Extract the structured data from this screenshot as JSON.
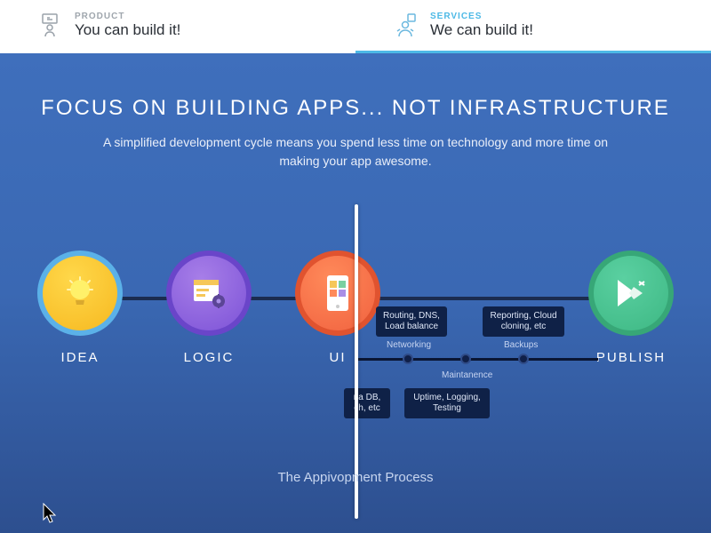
{
  "tabs": {
    "product": {
      "eyebrow": "PRODUCT",
      "title": "You can build it!"
    },
    "services": {
      "eyebrow": "SERVICES",
      "title": "We can build it!"
    }
  },
  "hero": {
    "heading": "FOCUS ON BUILDING APPS... NOT INFRASTRUCTURE",
    "subtext": "A simplified development cycle means you spend less time on technology and more time on making your app awesome."
  },
  "nodes": {
    "idea": "IDEA",
    "logic": "LOGIC",
    "ui": "UI",
    "publish": "PUBLISH"
  },
  "infra": {
    "routing": "Routing, DNS,\nLoad balance",
    "reporting": "Reporting, Cloud\ncloning, etc",
    "networking": "Networking",
    "backups": "Backups",
    "maintenance": "Maintanence",
    "db": "ria DB,\nch, etc",
    "uptime": "Uptime, Logging,\nTesting"
  },
  "caption": "The Appivopment Process"
}
